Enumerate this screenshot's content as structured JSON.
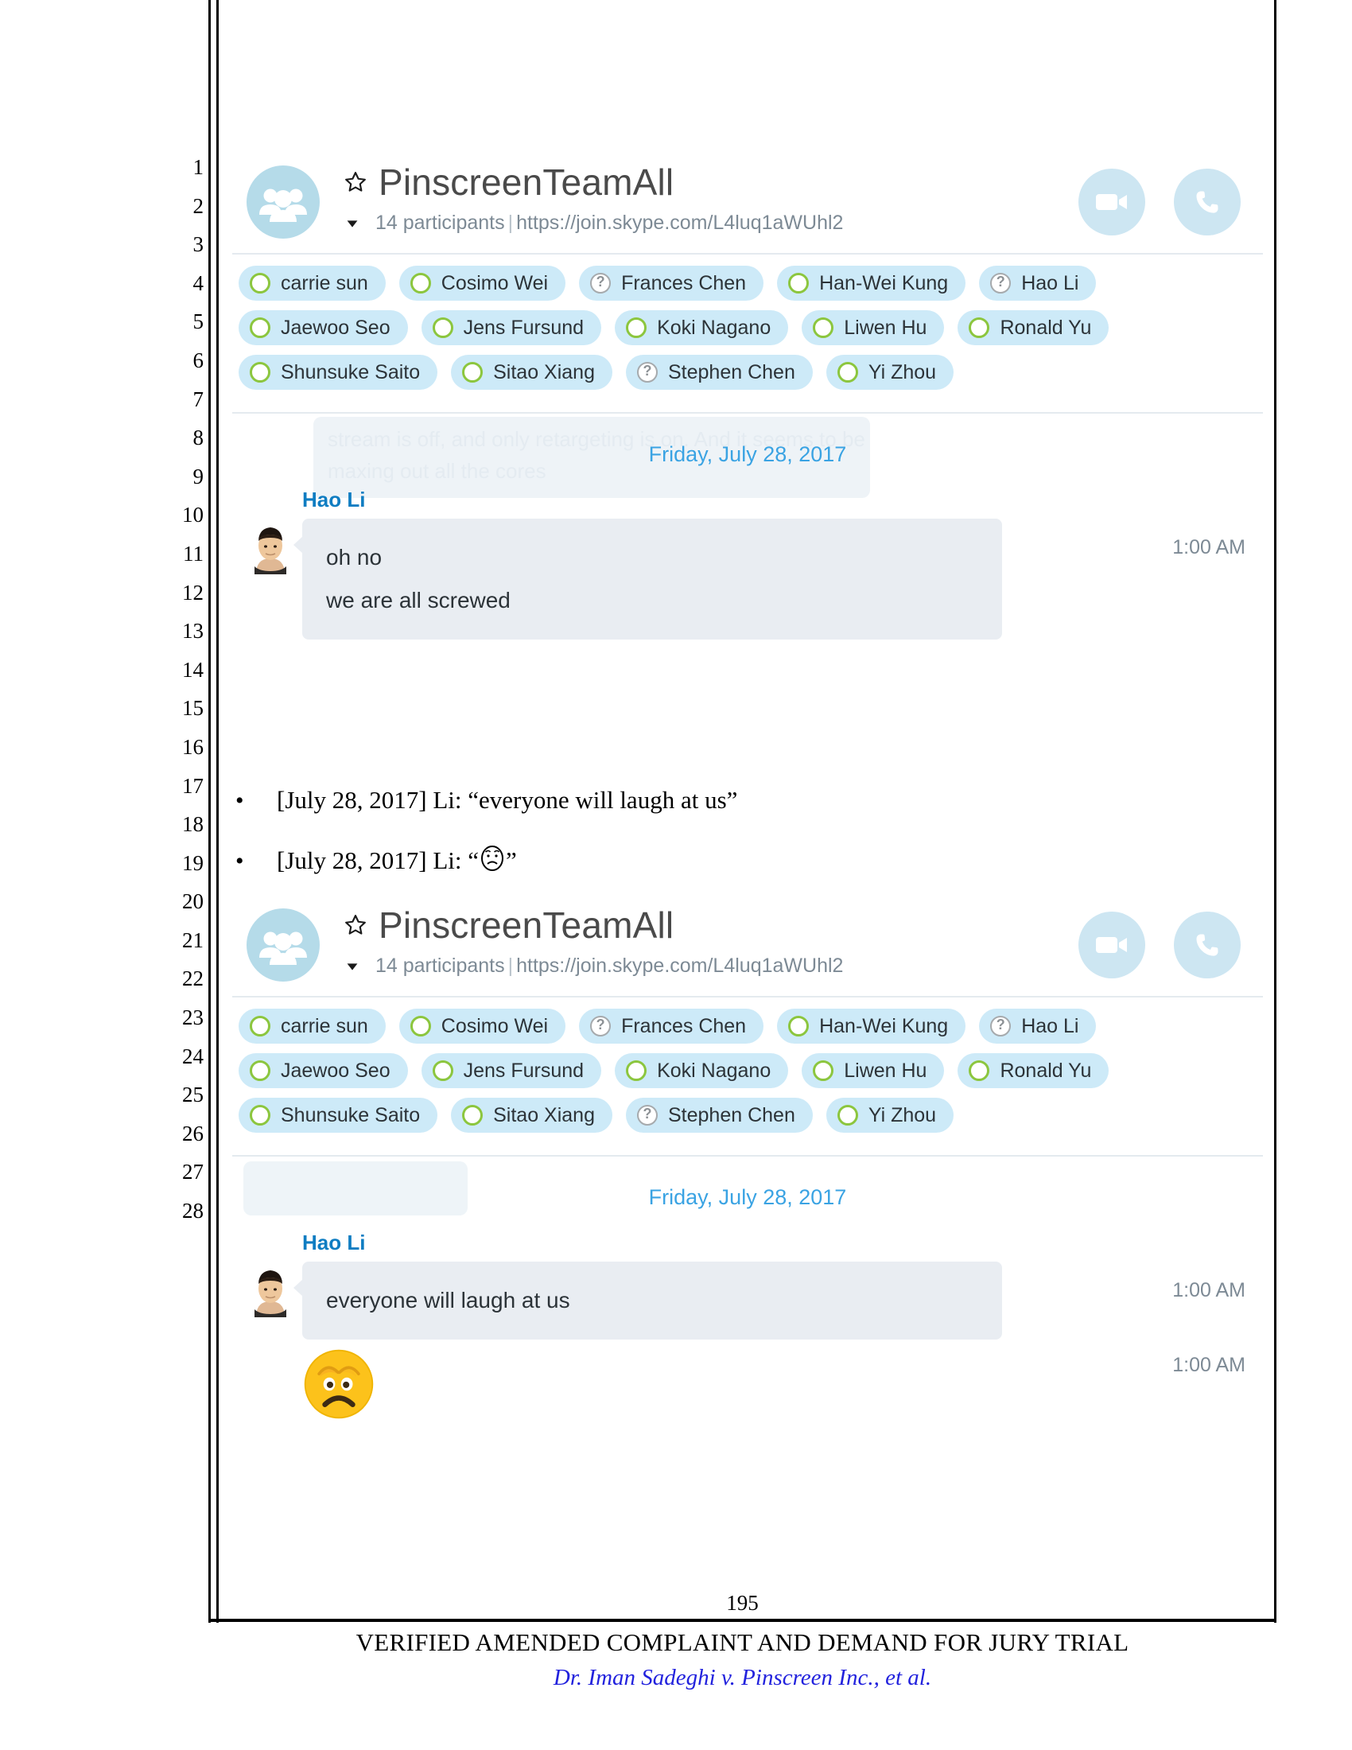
{
  "document": {
    "page_number": "195",
    "footer_title": "VERIFIED AMENDED COMPLAINT AND DEMAND FOR JURY TRIAL",
    "footer_case": "Dr. Iman Sadeghi v. Pinscreen Inc., et al.",
    "line_numbers": [
      "1",
      "2",
      "3",
      "4",
      "5",
      "6",
      "7",
      "8",
      "9",
      "10",
      "11",
      "12",
      "13",
      "14",
      "15",
      "16",
      "17",
      "18",
      "19",
      "20",
      "21",
      "22",
      "23",
      "24",
      "25",
      "26",
      "27",
      "28"
    ]
  },
  "colors": {
    "skype_blue": "#3aa3e3",
    "author_blue": "#0f7dc2",
    "chip_bg": "#cdeaf8",
    "status_online": "#8cc63e",
    "status_unknown": "#a6aaad",
    "bubble_bg": "#e9edf2",
    "avatar_bg": "#b5dbe9",
    "action_btn_bg": "#cde6f2",
    "case_link_blue": "#2222dd"
  },
  "screenshot_1": {
    "header": {
      "group_avatar_icon": "people-group-icon",
      "favorite_icon": "star-icon",
      "title": "PinscreenTeamAll",
      "expand_icon": "chevron-down-icon",
      "participant_count": "14 participants",
      "separator": "|",
      "join_url": "https://join.skype.com/L4luq1aWUhl2",
      "video_call_label": "video-call-button",
      "audio_call_label": "audio-call-button"
    },
    "participants": [
      [
        {
          "name": "carrie sun",
          "status": "online"
        },
        {
          "name": "Cosimo Wei",
          "status": "online"
        },
        {
          "name": "Frances Chen",
          "status": "unknown"
        },
        {
          "name": "Han-Wei Kung",
          "status": "online"
        },
        {
          "name": "Hao Li",
          "status": "unknown"
        }
      ],
      [
        {
          "name": "Jaewoo Seo",
          "status": "online"
        },
        {
          "name": "Jens Fursund",
          "status": "online"
        },
        {
          "name": "Koki Nagano",
          "status": "online"
        },
        {
          "name": "Liwen Hu",
          "status": "online"
        },
        {
          "name": "Ronald Yu",
          "status": "online"
        }
      ],
      [
        {
          "name": "Shunsuke Saito",
          "status": "online"
        },
        {
          "name": "Sitao Xiang",
          "status": "online"
        },
        {
          "name": "Stephen Chen",
          "status": "unknown"
        },
        {
          "name": "Yi Zhou",
          "status": "online"
        }
      ]
    ],
    "ghost_text_line1": "stream is off, and only retargeting is on. And it seems to be",
    "ghost_text_line2": "maxing out all the cores",
    "date_separator": "Friday, July 28, 2017",
    "message": {
      "author": "Hao Li",
      "avatar_icon": "user-photo-avatar",
      "lines": [
        "oh no",
        "we are all screwed"
      ],
      "time": "1:00 AM"
    }
  },
  "bullets": [
    "[July 28, 2017] Li: “everyone will laugh at us”",
    "[July 28, 2017] Li: “"
  ],
  "bullet_2_suffix": "”",
  "bullet_2_emoji_icon": "worried-face-emoji",
  "screenshot_2": {
    "header": {
      "group_avatar_icon": "people-group-icon",
      "favorite_icon": "star-icon",
      "title": "PinscreenTeamAll",
      "expand_icon": "chevron-down-icon",
      "participant_count": "14 participants",
      "separator": "|",
      "join_url": "https://join.skype.com/L4luq1aWUhl2",
      "video_call_label": "video-call-button",
      "audio_call_label": "audio-call-button"
    },
    "participants": [
      [
        {
          "name": "carrie sun",
          "status": "online"
        },
        {
          "name": "Cosimo Wei",
          "status": "online"
        },
        {
          "name": "Frances Chen",
          "status": "unknown"
        },
        {
          "name": "Han-Wei Kung",
          "status": "online"
        },
        {
          "name": "Hao Li",
          "status": "unknown"
        }
      ],
      [
        {
          "name": "Jaewoo Seo",
          "status": "online"
        },
        {
          "name": "Jens Fursund",
          "status": "online"
        },
        {
          "name": "Koki Nagano",
          "status": "online"
        },
        {
          "name": "Liwen Hu",
          "status": "online"
        },
        {
          "name": "Ronald Yu",
          "status": "online"
        }
      ],
      [
        {
          "name": "Shunsuke Saito",
          "status": "online"
        },
        {
          "name": "Sitao Xiang",
          "status": "online"
        },
        {
          "name": "Stephen Chen",
          "status": "unknown"
        },
        {
          "name": "Yi Zhou",
          "status": "online"
        }
      ]
    ],
    "date_separator": "Friday, July 28, 2017",
    "message": {
      "author": "Hao Li",
      "avatar_icon": "user-photo-avatar",
      "text": "everyone will laugh at us",
      "time": "1:00 AM",
      "emoji_icon": "worried-face-emoji",
      "emoji_time": "1:00 AM"
    }
  }
}
